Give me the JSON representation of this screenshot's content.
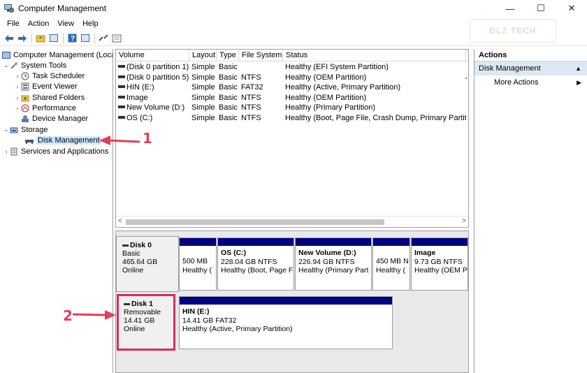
{
  "window": {
    "title": "Computer Management"
  },
  "menu": [
    "File",
    "Action",
    "View",
    "Help"
  ],
  "watermark": "DLZ TECH",
  "tree": {
    "root": "Computer Management (Local",
    "system_tools": "System Tools",
    "task_scheduler": "Task Scheduler",
    "event_viewer": "Event Viewer",
    "shared_folders": "Shared Folders",
    "performance": "Performance",
    "device_manager": "Device Manager",
    "storage": "Storage",
    "disk_management": "Disk Management",
    "services_apps": "Services and Applications"
  },
  "volume_table": {
    "headers": [
      "Volume",
      "Layout",
      "Type",
      "File System",
      "Status"
    ],
    "rows": [
      [
        "(Disk 0 partition 1)",
        "Simple",
        "Basic",
        "",
        "Healthy (EFI System Partition)"
      ],
      [
        "(Disk 0 partition 5)",
        "Simple",
        "Basic",
        "NTFS",
        "Healthy (OEM Partition)"
      ],
      [
        "HIN (E:)",
        "Simple",
        "Basic",
        "FAT32",
        "Healthy (Active, Primary Partition)"
      ],
      [
        "Image",
        "Simple",
        "Basic",
        "NTFS",
        "Healthy (OEM Partition)"
      ],
      [
        "New Volume (D:)",
        "Simple",
        "Basic",
        "NTFS",
        "Healthy (Primary Partition)"
      ],
      [
        "OS (C:)",
        "Simple",
        "Basic",
        "NTFS",
        "Healthy (Boot, Page File, Crash Dump, Primary Partition)"
      ]
    ]
  },
  "disk0": {
    "name": "Disk 0",
    "type": "Basic",
    "size": "465.64 GB",
    "status": "Online",
    "partitions": [
      {
        "title": "",
        "line1": "500 MB",
        "line2": "Healthy ("
      },
      {
        "title": "OS  (C:)",
        "line1": "228.04 GB NTFS",
        "line2": "Healthy (Boot, Page F"
      },
      {
        "title": "New Volume  (D:)",
        "line1": "226.94 GB NTFS",
        "line2": "Healthy (Primary Part"
      },
      {
        "title": "",
        "line1": "450 MB N",
        "line2": "Healthy ("
      },
      {
        "title": "Image",
        "line1": "9.73 GB NTFS",
        "line2": "Healthy (OEM P"
      }
    ]
  },
  "disk1": {
    "name": "Disk 1",
    "type": "Removable",
    "size": "14.41 GB",
    "status": "Online",
    "partition": {
      "title": "HIN  (E:)",
      "line1": "14.41 GB FAT32",
      "line2": "Healthy (Active, Primary Partition)"
    }
  },
  "actions": {
    "header": "Actions",
    "section": "Disk Management",
    "more": "More Actions"
  },
  "annotations": {
    "one": "1",
    "two": "2"
  },
  "colors": {
    "partition_bar": "#000082",
    "annotation": "#e0405a",
    "selection": "#cce8ff"
  }
}
